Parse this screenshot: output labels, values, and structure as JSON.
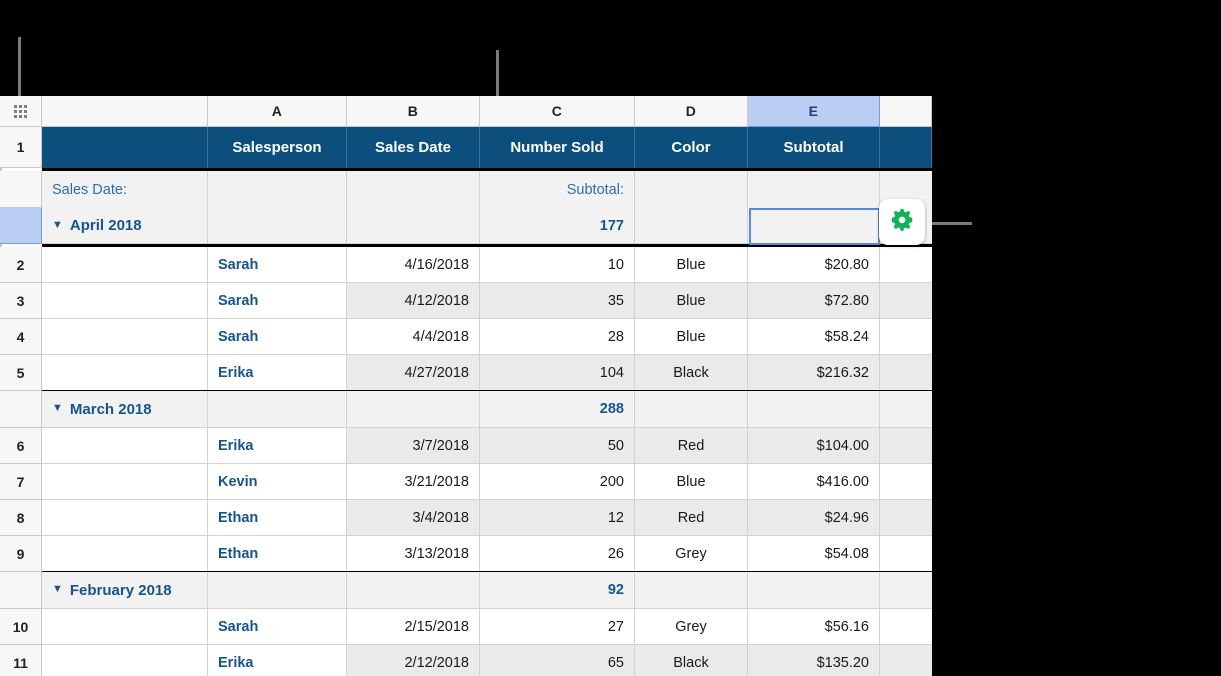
{
  "app": {
    "type": "spreadsheet",
    "theme": {
      "header_fill": "#0d4f7c",
      "header_text": "#ffffff",
      "accent_blue": "#16558c",
      "selection_blue": "#5b87d8",
      "column_select_fill": "#b9cef2",
      "band_grey": "#eaeaea",
      "group_fill": "#f2f2f2",
      "gear_green": "#0fb256",
      "callout_grey": "#7b7b7b"
    }
  },
  "column_headers": [
    {
      "label": "A",
      "selected": false
    },
    {
      "label": "B",
      "selected": false
    },
    {
      "label": "C",
      "selected": false
    },
    {
      "label": "D",
      "selected": false
    },
    {
      "label": "E",
      "selected": true
    }
  ],
  "table_handle": {
    "icon": "grid-dots-icon"
  },
  "header_row": {
    "row_number": "1",
    "cells": [
      "",
      "Salesperson",
      "Sales Date",
      "Number Sold",
      "Color",
      "Subtotal",
      ""
    ]
  },
  "category_label": "Sales Date:",
  "subtotal_label": "Subtotal:",
  "groups": [
    {
      "title": "April 2018",
      "disclosure": "collapse-triangle-icon",
      "subtotal_number_sold": "177",
      "subtotal_amount": "",
      "selected_row_header": true,
      "rows": [
        {
          "row_number": "2",
          "salesperson": "Sarah",
          "sales_date": "4/16/2018",
          "number_sold": "10",
          "color": "Blue",
          "subtotal": "$20.80",
          "band": "white"
        },
        {
          "row_number": "3",
          "salesperson": "Sarah",
          "sales_date": "4/12/2018",
          "number_sold": "35",
          "color": "Blue",
          "subtotal": "$72.80",
          "band": "grey"
        },
        {
          "row_number": "4",
          "salesperson": "Sarah",
          "sales_date": "4/4/2018",
          "number_sold": "28",
          "color": "Blue",
          "subtotal": "$58.24",
          "band": "white"
        },
        {
          "row_number": "5",
          "salesperson": "Erika",
          "sales_date": "4/27/2018",
          "number_sold": "104",
          "color": "Black",
          "subtotal": "$216.32",
          "band": "grey"
        }
      ]
    },
    {
      "title": "March 2018",
      "disclosure": "collapse-triangle-icon",
      "subtotal_number_sold": "288",
      "subtotal_amount": "",
      "selected_row_header": false,
      "rows": [
        {
          "row_number": "6",
          "salesperson": "Erika",
          "sales_date": "3/7/2018",
          "number_sold": "50",
          "color": "Red",
          "subtotal": "$104.00",
          "band": "grey"
        },
        {
          "row_number": "7",
          "salesperson": "Kevin",
          "sales_date": "3/21/2018",
          "number_sold": "200",
          "color": "Blue",
          "subtotal": "$416.00",
          "band": "white"
        },
        {
          "row_number": "8",
          "salesperson": "Ethan",
          "sales_date": "3/4/2018",
          "number_sold": "12",
          "color": "Red",
          "subtotal": "$24.96",
          "band": "grey"
        },
        {
          "row_number": "9",
          "salesperson": "Ethan",
          "sales_date": "3/13/2018",
          "number_sold": "26",
          "color": "Grey",
          "subtotal": "$54.08",
          "band": "white"
        }
      ]
    },
    {
      "title": "February 2018",
      "disclosure": "collapse-triangle-icon",
      "subtotal_number_sold": "92",
      "subtotal_amount": "",
      "selected_row_header": false,
      "rows": [
        {
          "row_number": "10",
          "salesperson": "Sarah",
          "sales_date": "2/15/2018",
          "number_sold": "27",
          "color": "Grey",
          "subtotal": "$56.16",
          "band": "white"
        },
        {
          "row_number": "11",
          "salesperson": "Erika",
          "sales_date": "2/12/2018",
          "number_sold": "65",
          "color": "Black",
          "subtotal": "$135.20",
          "band": "grey"
        }
      ]
    }
  ],
  "selected_cell": {
    "column": "E",
    "value": ""
  },
  "gear_button": {
    "icon": "gear-icon",
    "label": ""
  },
  "callouts": [
    {
      "name": "callout-to-row-handle",
      "target": "group-row-handle"
    },
    {
      "name": "callout-to-subtotal-value",
      "target": "subtotal-177"
    },
    {
      "name": "callout-to-gear-button",
      "target": "gear-button"
    }
  ]
}
